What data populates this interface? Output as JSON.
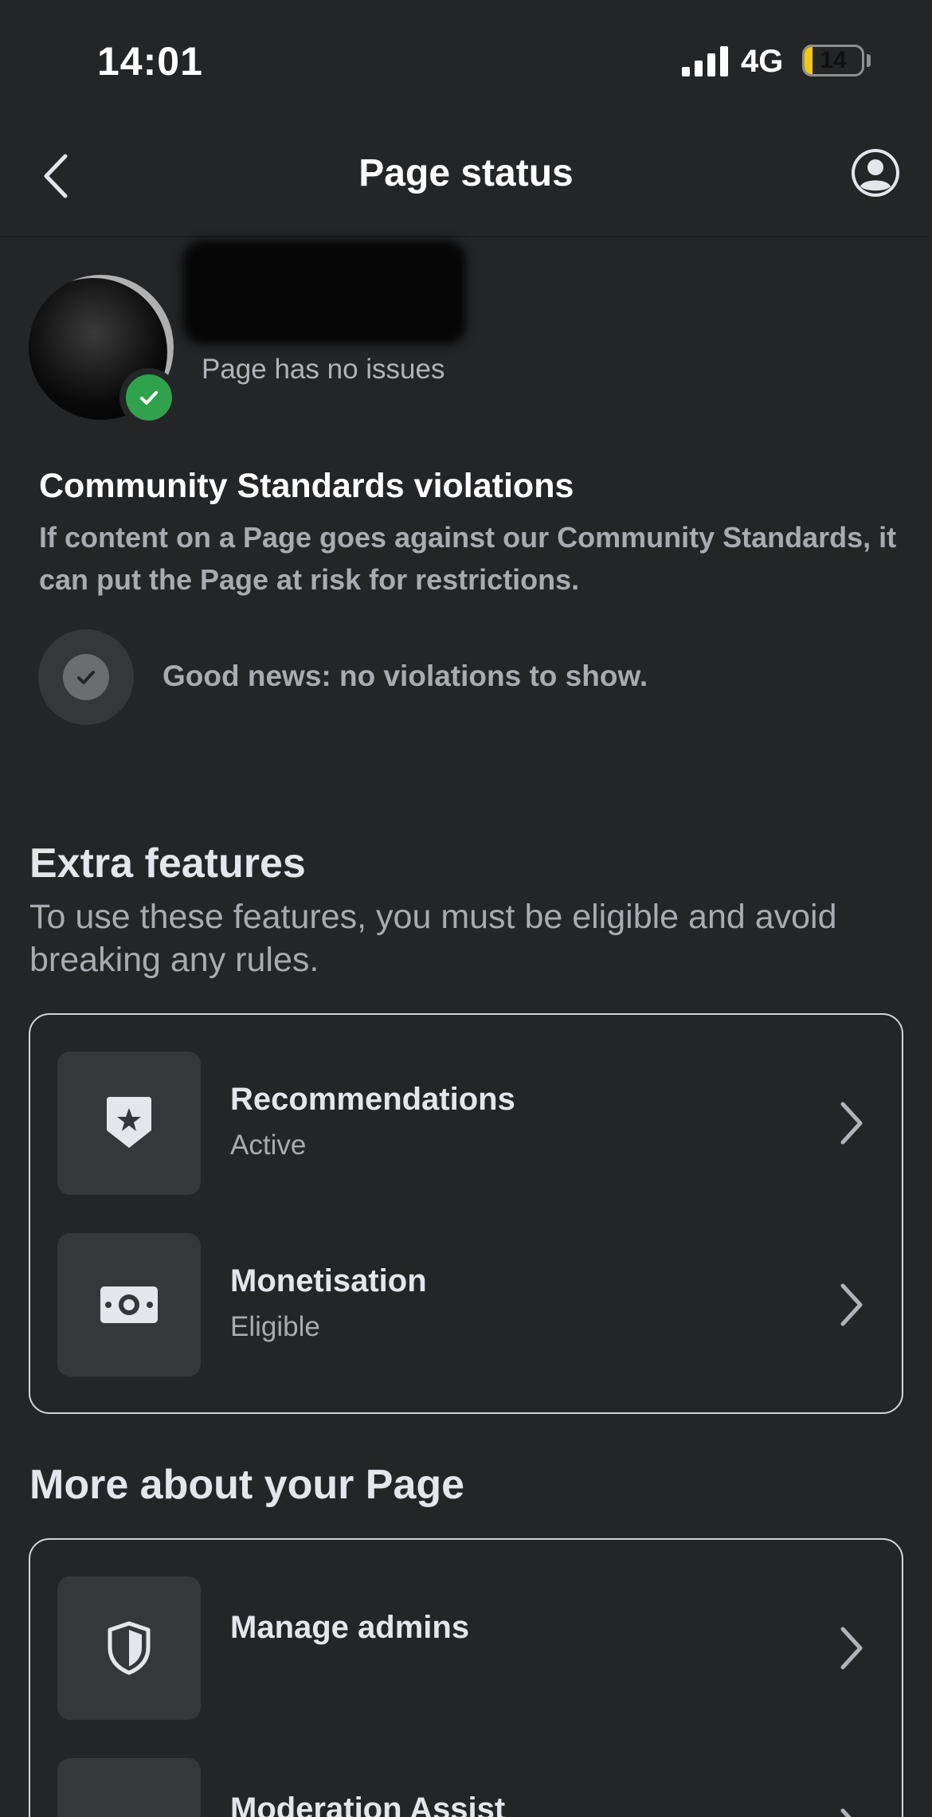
{
  "status_bar": {
    "time": "14:01",
    "network": "4G",
    "battery": "14",
    "battery_fraction": 0.14,
    "battery_color": "#f4c80f"
  },
  "nav": {
    "title": "Page status",
    "back_icon": "chevron-left-icon",
    "profile_icon": "person-circle-icon"
  },
  "page": {
    "status_text": "Page has no issues",
    "status_color": "#31a24c"
  },
  "community_standards": {
    "title": "Community Standards violations",
    "description": "If content on a Page goes against our Community Standards, it can put the Page at risk for restrictions.",
    "empty_message": "Good news: no violations to show."
  },
  "extra_features": {
    "title": "Extra features",
    "description": "To use these features, you must be eligible and avoid breaking any rules.",
    "items": [
      {
        "label": "Recommendations",
        "status": "Active",
        "icon": "badge-star-icon"
      },
      {
        "label": "Monetisation",
        "status": "Eligible",
        "icon": "banknote-icon"
      }
    ]
  },
  "more_about": {
    "title": "More about your Page",
    "items": [
      {
        "label": "Manage admins",
        "icon": "shield-icon"
      },
      {
        "label": "Moderation Assist",
        "icon": "infinity-icon"
      }
    ]
  }
}
